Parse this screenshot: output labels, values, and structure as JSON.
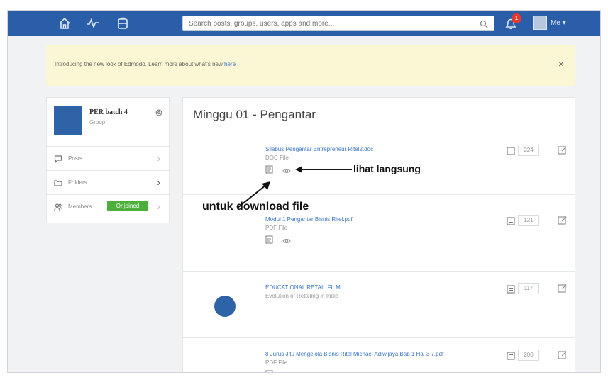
{
  "topbar": {
    "search_placeholder": "Search posts, groups, users, apps and more...",
    "notification_count": "1",
    "me_label": "Me ▾"
  },
  "notice": {
    "text": "Introducing the new look of Edmodo. Learn more about what's new ",
    "link": "here"
  },
  "group": {
    "name": "PER batch 4",
    "subtitle": "Group"
  },
  "sidebar": {
    "items": [
      {
        "label": "Posts"
      },
      {
        "label": "Folders"
      },
      {
        "label": "Members",
        "button": "Or joined"
      }
    ]
  },
  "folder": {
    "title": "Minggu 01 - Pengantar",
    "items": [
      {
        "name": "Silabus Pengantar Entrepreneur Ritel2.doc",
        "type": "DOC File",
        "count": "224"
      },
      {
        "name": "Modul 1 Pengantar Bisnis Ritel.pdf",
        "type": "PDF File",
        "count": "121"
      },
      {
        "name": "EDUCATIONAL RETAIL FILM",
        "type": "Evolution of Retailing in India",
        "count": "117"
      },
      {
        "name": "8 Jurus Jitu Mengelola Bisnis Ritel Michael Adiwijaya Bab 1 Hal 3 7.pdf",
        "type": "PDF File",
        "count": "200"
      }
    ]
  },
  "annotations": {
    "view_label": "lihat langsung",
    "download_label": "untuk download file"
  }
}
